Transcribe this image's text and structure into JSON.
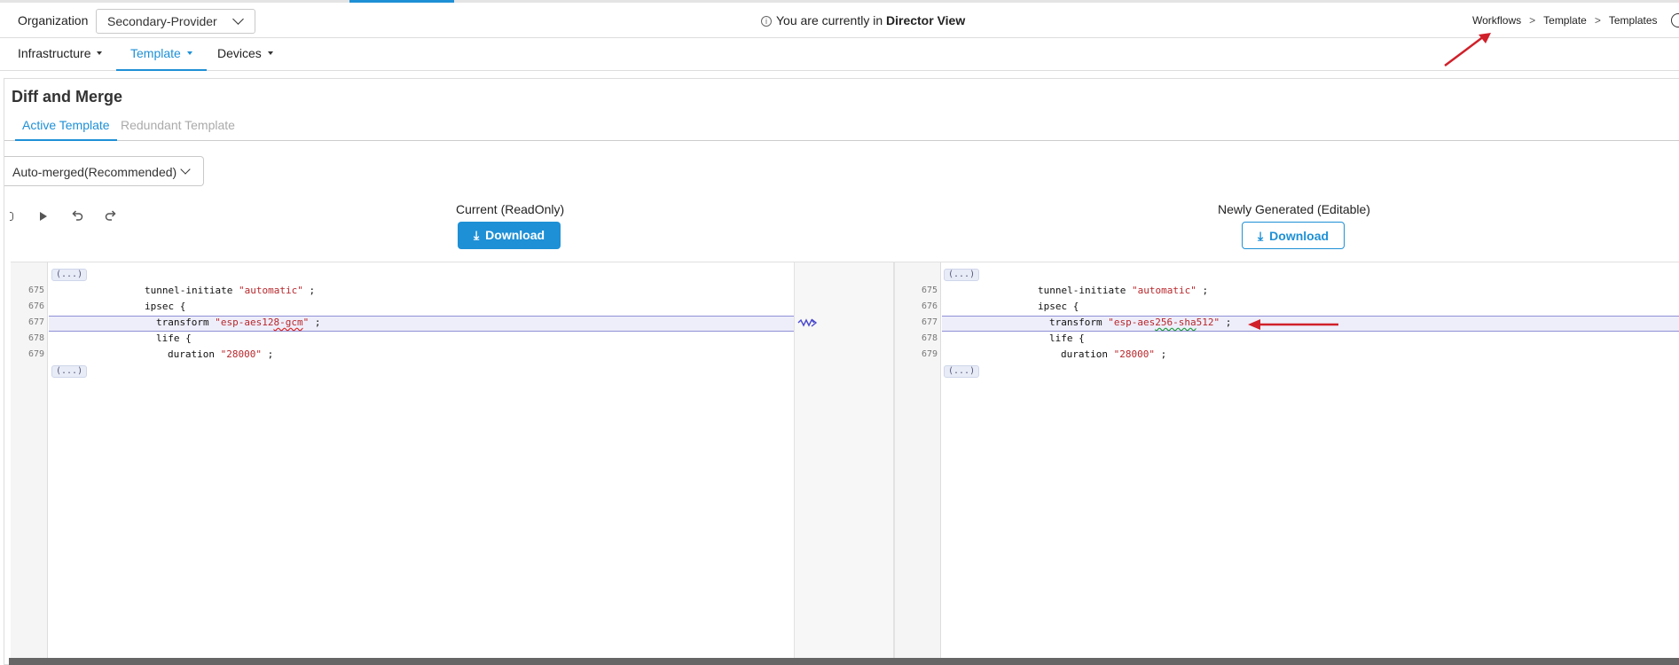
{
  "header": {
    "org_label": "Organization",
    "org_value": "Secondary-Provider",
    "director_prefix": "You are currently in",
    "director_view": "Director View",
    "breadcrumb": [
      "Workflows",
      "Template",
      "Templates"
    ]
  },
  "nav": {
    "items": [
      {
        "label": "Infrastructure"
      },
      {
        "label": "Template"
      },
      {
        "label": "Devices"
      }
    ]
  },
  "page": {
    "title": "Diff and Merge",
    "tabs": [
      "Active Template",
      "Redundant Template"
    ],
    "merge_mode": "Auto-merged(Recommended)"
  },
  "left_pane": {
    "label": "Current (ReadOnly)",
    "download": "Download",
    "fold_marker": "(...)",
    "line_numbers": [
      "675",
      "676",
      "677",
      "678",
      "679"
    ],
    "lines": {
      "l675_key": "tunnel-initiate ",
      "l675_val": "\"automatic\"",
      "l675_end": " ;",
      "l676": "ipsec {",
      "l677_key": "transform ",
      "l677_val_a": "\"esp-aes12",
      "l677_val_b": "8-gcm",
      "l677_val_c": "\"",
      "l677_end": " ;",
      "l678": "life {",
      "l679_key": "duration ",
      "l679_val": "\"28000\"",
      "l679_end": " ;"
    }
  },
  "right_pane": {
    "label": "Newly Generated (Editable)",
    "download": "Download",
    "fold_marker": "(...)",
    "line_numbers": [
      "675",
      "676",
      "677",
      "678",
      "679"
    ],
    "lines": {
      "l675_key": "tunnel-initiate ",
      "l675_val": "\"automatic\"",
      "l675_end": " ;",
      "l676": "ipsec {",
      "l677_key": "transform ",
      "l677_val_a": "\"esp-aes",
      "l677_val_b": "256-sha",
      "l677_val_c": "512\"",
      "l677_end": " ;",
      "l678": "life {",
      "l679_key": "duration ",
      "l679_val": "\"28000\"",
      "l679_end": " ;"
    }
  },
  "colors": {
    "accent": "#1e90d6",
    "annotation_arrow": "#d0202a",
    "string": "#b8272c"
  },
  "icons": [
    "info-icon",
    "chevron-down-icon",
    "play-icon",
    "undo-icon",
    "redo-icon",
    "download-icon",
    "merge-arrow-icon"
  ]
}
